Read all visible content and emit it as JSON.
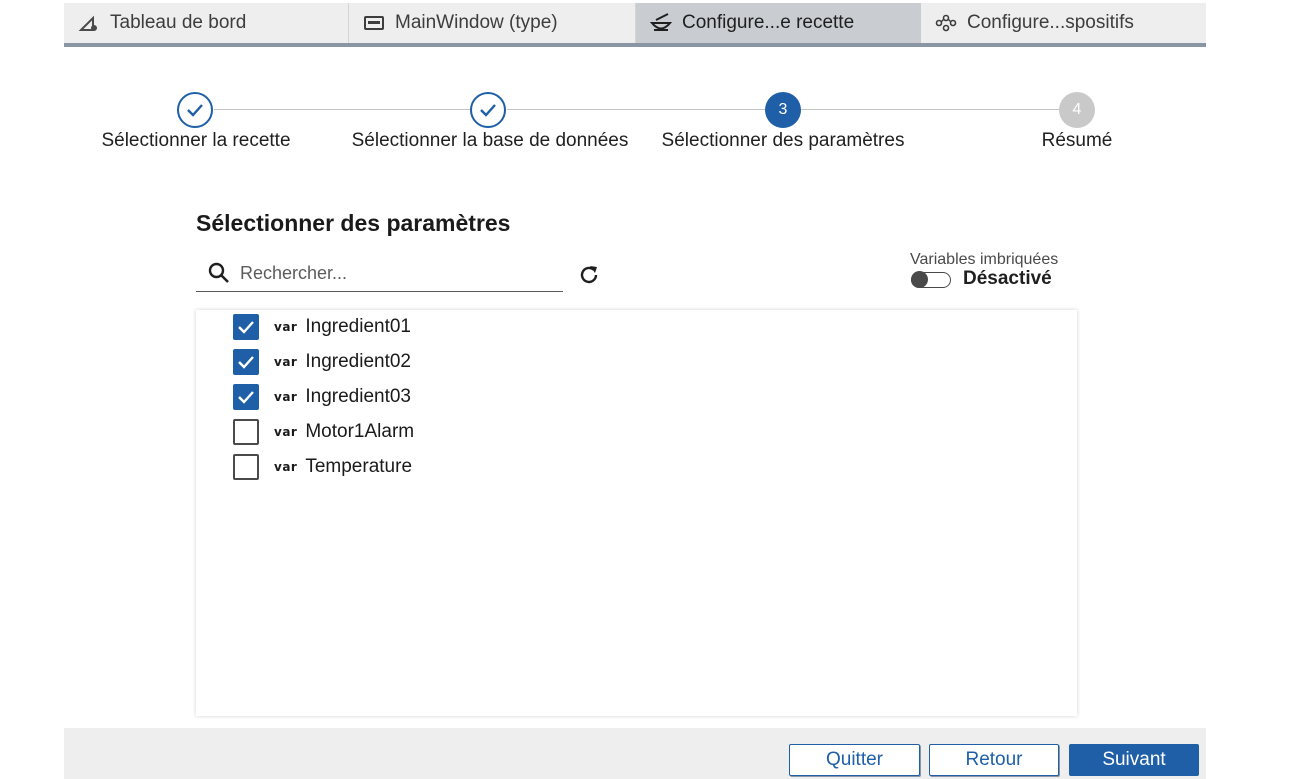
{
  "tabs": [
    {
      "label": "Tableau de bord",
      "icon": "dashboard-icon",
      "active": false
    },
    {
      "label": "MainWindow (type)",
      "icon": "window-icon",
      "active": false
    },
    {
      "label": "Configure...e recette",
      "icon": "recipe-icon",
      "active": true
    },
    {
      "label": "Configure...spositifs",
      "icon": "devices-icon",
      "active": false
    }
  ],
  "stepper": {
    "steps": [
      {
        "label": "Sélectionner la recette",
        "state": "done",
        "number": "1"
      },
      {
        "label": "Sélectionner la base de données",
        "state": "done",
        "number": "2"
      },
      {
        "label": "Sélectionner des paramètres",
        "state": "active",
        "number": "3"
      },
      {
        "label": "Résumé",
        "state": "pending",
        "number": "4"
      }
    ]
  },
  "section": {
    "title": "Sélectionner des paramètres"
  },
  "search": {
    "placeholder": "Rechercher..."
  },
  "nested_variables": {
    "label": "Variables imbriquées",
    "state": "Désactivé",
    "enabled": false
  },
  "parameters": {
    "type_tag": "var",
    "items": [
      {
        "name": "Ingredient01",
        "checked": true
      },
      {
        "name": "Ingredient02",
        "checked": true
      },
      {
        "name": "Ingredient03",
        "checked": true
      },
      {
        "name": "Motor1Alarm",
        "checked": false
      },
      {
        "name": "Temperature",
        "checked": false
      }
    ]
  },
  "footer": {
    "quit_label": "Quitter",
    "back_label": "Retour",
    "next_label": "Suivant"
  },
  "colors": {
    "accent": "#1e5fa8",
    "tab_active_bg": "#c9cdd1",
    "bar_bg": "#eeeeee"
  }
}
